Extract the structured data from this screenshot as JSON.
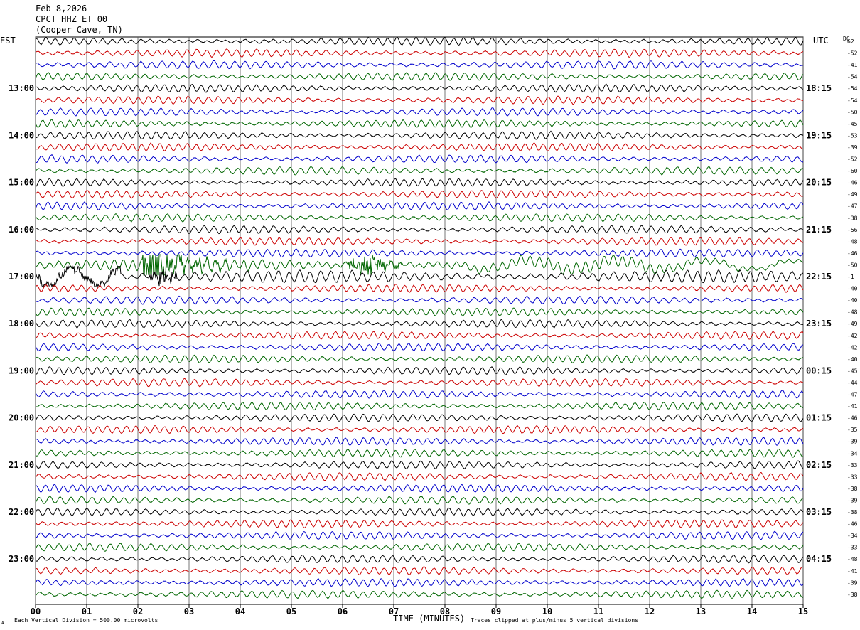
{
  "header": {
    "line1": "Feb 8,2026",
    "line2": "CPCT HHZ ET 00",
    "line3": "(Cooper Cave, TN)",
    "left_tz": "EST",
    "right_tz": "UTC",
    "dc_label": "DC"
  },
  "footer": {
    "xlabel": "TIME (MINUTES)",
    "scale_note": "Each Vertical Division =  500.00 microvolts",
    "clip_note": "Traces clipped at plus/minus 5 vertical divisions",
    "corner_mark": "A"
  },
  "chart_data": {
    "type": "line",
    "title": "CPCT HHZ ET 00 (Cooper Cave, TN) Feb 8,2026",
    "xlabel": "TIME (MINUTES)",
    "ylabel": "",
    "x_ticks": [
      "00",
      "01",
      "02",
      "03",
      "04",
      "05",
      "06",
      "07",
      "08",
      "09",
      "10",
      "11",
      "12",
      "13",
      "14",
      "15"
    ],
    "xlim": [
      0,
      15
    ],
    "grid": true,
    "trace_colors": [
      "#000000",
      "#cc0000",
      "#0000cc",
      "#006600"
    ],
    "left_hour_labels": [
      "13:00",
      "14:00",
      "15:00",
      "16:00",
      "17:00",
      "18:00",
      "19:00",
      "20:00",
      "21:00",
      "22:00",
      "23:00"
    ],
    "right_hour_labels": [
      "18:15",
      "19:15",
      "20:15",
      "21:15",
      "22:15",
      "23:15",
      "00:15",
      "01:15",
      "02:15",
      "03:15",
      "04:15"
    ],
    "dc_offsets": [
      62,
      -52,
      -41,
      -54,
      -54,
      -54,
      -50,
      -45,
      -53,
      -39,
      -52,
      -60,
      -46,
      -49,
      -47,
      -38,
      -56,
      -48,
      -46,
      -50,
      -1,
      -40,
      -40,
      -48,
      -49,
      -42,
      -42,
      -40,
      -45,
      -44,
      -47,
      -41,
      -46,
      -35,
      -39,
      -34,
      -33,
      -33,
      -38,
      -39,
      -38,
      -46,
      -34,
      -33,
      -48,
      -41,
      -39,
      -38
    ],
    "event_traces": [
      {
        "row": 19,
        "description": "largest event"
      },
      {
        "row": 20
      }
    ]
  }
}
